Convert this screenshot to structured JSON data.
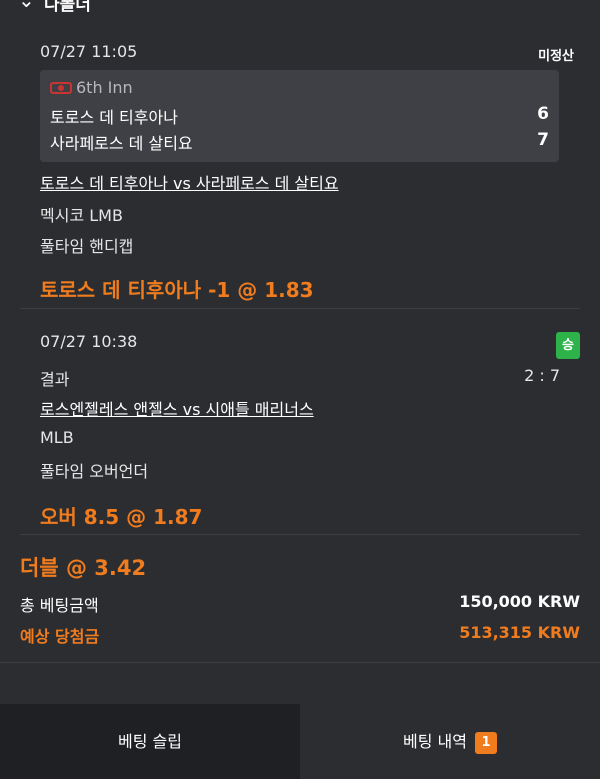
{
  "header": {
    "title": "다폴더"
  },
  "bets": [
    {
      "datetime": "07/27 11:05",
      "status": "미정산",
      "live": {
        "inning": "6th Inn",
        "home": {
          "team": "토로스 데 티후아나",
          "score": "6"
        },
        "away": {
          "team": "사라페로스 데 살티요",
          "score": "7"
        }
      },
      "match": "토로스 데 티후아나 vs 사라페로스 데 살티요",
      "league": "멕시코 LMB",
      "market": "풀타임 핸디캡",
      "pick": "토로스 데 티후아나 -1 @ 1.83"
    },
    {
      "datetime": "07/27 10:38",
      "status": "승",
      "result_label": "결과",
      "result_score": "2 : 7",
      "match": "로스엔젤레스 앤젤스 vs 시애틀 매리너스",
      "league": "MLB",
      "market": "풀타임 오버언더",
      "pick": "오버 8.5 @ 1.87"
    }
  ],
  "summary": {
    "double": "더블 @ 3.42",
    "total_label": "총 베팅금액",
    "total_value": "150,000 KRW",
    "expected_label": "예상 당첨금",
    "expected_value": "513,315 KRW"
  },
  "tabs": {
    "slip": "베팅 슬립",
    "history": "베팅 내역",
    "history_count": "1"
  },
  "colors": {
    "accent": "#f07c1e",
    "win": "#2db34a",
    "background": "#2b2d31"
  },
  "icons": {
    "header": "chevron-down-icon",
    "live": "baseball-live-icon"
  }
}
